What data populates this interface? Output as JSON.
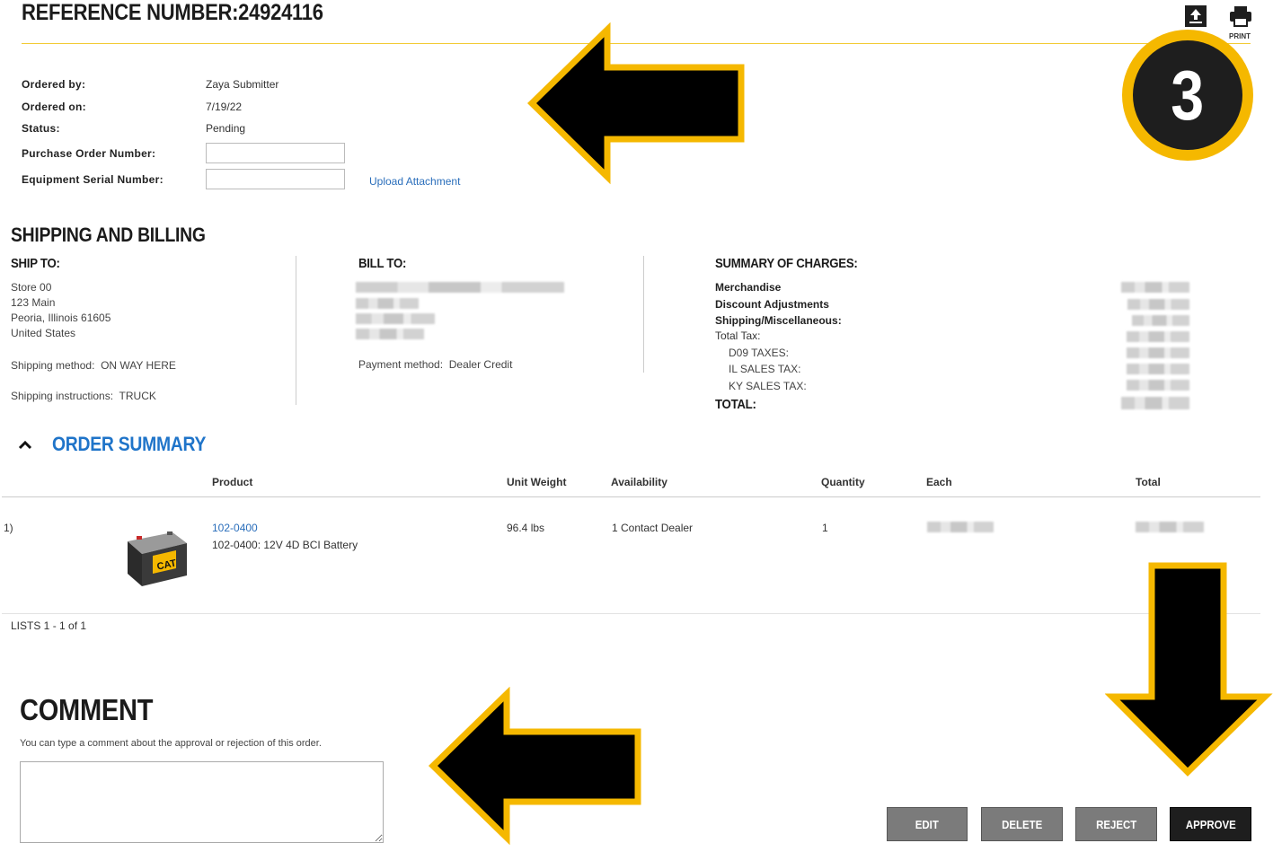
{
  "header": {
    "reference_title": "REFERENCE NUMBER:24924116",
    "print_label": "PRINT"
  },
  "order_info": {
    "ordered_by_label": "Ordered by:",
    "ordered_by_value": "Zaya Submitter",
    "ordered_on_label": "Ordered on:",
    "ordered_on_value": "7/19/22",
    "status_label": "Status:",
    "status_value": "Pending",
    "po_label": "Purchase Order Number:",
    "po_value": "",
    "serial_label": "Equipment Serial Number:",
    "serial_value": "",
    "upload_link": "Upload Attachment"
  },
  "shipping_billing": {
    "title": "SHIPPING AND BILLING",
    "ship_to": {
      "title": "SHIP TO:",
      "lines": [
        "Store 00",
        "123 Main",
        "Peoria, Illinois 61605",
        "United States"
      ],
      "method_label": "Shipping method:",
      "method_value": "ON WAY HERE",
      "instructions_label": "Shipping instructions:",
      "instructions_value": "TRUCK"
    },
    "bill_to": {
      "title": "BILL TO:",
      "payment_label": "Payment method:",
      "payment_value": "Dealer Credit"
    },
    "summary": {
      "title": "SUMMARY OF CHARGES:",
      "merchandise": "Merchandise",
      "discount": "Discount Adjustments",
      "shipping": "Shipping/Miscellaneous:",
      "total_tax": "Total Tax:",
      "tax_lines": [
        "D09 TAXES:",
        "IL SALES TAX:",
        "KY SALES TAX:"
      ],
      "total": "TOTAL:"
    }
  },
  "order_summary": {
    "title": "ORDER SUMMARY",
    "columns": [
      "Product",
      "Unit Weight",
      "Availability",
      "Quantity",
      "Each",
      "Total"
    ],
    "rows": [
      {
        "index": "1)",
        "part_link": "102-0400",
        "description": "102-0400: 12V 4D BCI Battery",
        "unit_weight": "96.4 lbs",
        "availability": "1 Contact Dealer",
        "quantity": "1",
        "product_image_brand": "CAT"
      }
    ],
    "pagination": "LISTS 1 - 1 of 1"
  },
  "comment": {
    "title": "COMMENT",
    "hint": "You can type a comment about the approval or rejection of this order.",
    "value": ""
  },
  "actions": {
    "edit": "EDIT",
    "delete": "DELETE",
    "reject": "REJECT",
    "approve": "APPROVE"
  },
  "annotations": {
    "step_number": "3",
    "accent_color": "#f5b800",
    "arrow_color": "#000000"
  }
}
